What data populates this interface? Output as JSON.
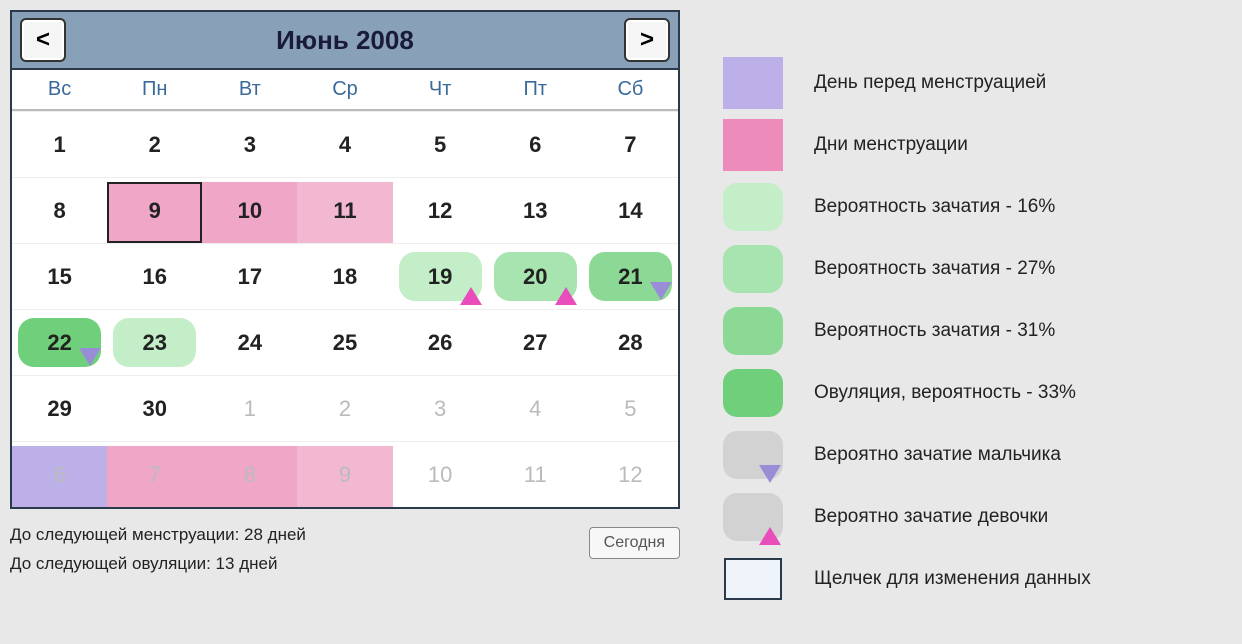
{
  "calendar": {
    "title": "Июнь 2008",
    "weekdays": [
      "Вс",
      "Пн",
      "Вт",
      "Ср",
      "Чт",
      "Пт",
      "Сб"
    ],
    "rows": [
      [
        {
          "n": "1"
        },
        {
          "n": "2"
        },
        {
          "n": "3"
        },
        {
          "n": "4"
        },
        {
          "n": "5"
        },
        {
          "n": "6"
        },
        {
          "n": "7"
        }
      ],
      [
        {
          "n": "8"
        },
        {
          "n": "9",
          "cls": "c-menst-start"
        },
        {
          "n": "10",
          "cls": "c-menst"
        },
        {
          "n": "11",
          "cls": "c-menst-mid"
        },
        {
          "n": "12"
        },
        {
          "n": "13"
        },
        {
          "n": "14"
        }
      ],
      [
        {
          "n": "15"
        },
        {
          "n": "16"
        },
        {
          "n": "17"
        },
        {
          "n": "18"
        },
        {
          "n": "19",
          "cls": "c-fert1",
          "marker": "pink"
        },
        {
          "n": "20",
          "cls": "c-fert2",
          "marker": "pink"
        },
        {
          "n": "21",
          "cls": "c-fert3",
          "marker": "purple"
        }
      ],
      [
        {
          "n": "22",
          "cls": "c-ovul",
          "marker": "purple"
        },
        {
          "n": "23",
          "cls": "c-fert1"
        },
        {
          "n": "24"
        },
        {
          "n": "25"
        },
        {
          "n": "26"
        },
        {
          "n": "27"
        },
        {
          "n": "28"
        }
      ],
      [
        {
          "n": "29"
        },
        {
          "n": "30"
        },
        {
          "n": "1",
          "other": true
        },
        {
          "n": "2",
          "other": true
        },
        {
          "n": "3",
          "other": true
        },
        {
          "n": "4",
          "other": true
        },
        {
          "n": "5",
          "other": true
        }
      ],
      [
        {
          "n": "6",
          "other": true,
          "cls": "c-premenst"
        },
        {
          "n": "7",
          "other": true,
          "cls": "c-menst"
        },
        {
          "n": "8",
          "other": true,
          "cls": "c-menst"
        },
        {
          "n": "9",
          "other": true,
          "cls": "c-menst-mid"
        },
        {
          "n": "10",
          "other": true
        },
        {
          "n": "11",
          "other": true
        },
        {
          "n": "12",
          "other": true
        }
      ]
    ]
  },
  "nav": {
    "prev": "<",
    "next": ">"
  },
  "status": {
    "line1": "До следующей менструации: 28 дней",
    "line2": "До следующей овуляции: 13 дней"
  },
  "today_label": "Сегодня",
  "legend": {
    "items": [
      {
        "kind": "rect",
        "color": "#bdb0e8",
        "text": "День перед менструацией"
      },
      {
        "kind": "rect",
        "color": "#ed8cbb",
        "text": "Дни менструации"
      },
      {
        "kind": "pill",
        "color": "#c3eec7",
        "text": "Вероятность зачатия - 16%"
      },
      {
        "kind": "pill",
        "color": "#a7e4af",
        "text": "Вероятность зачатия - 27%"
      },
      {
        "kind": "pill",
        "color": "#8bd994",
        "text": "Вероятность зачатия - 31%"
      },
      {
        "kind": "pill",
        "color": "#6fcf7a",
        "text": "Овуляция, вероятность - 33%"
      },
      {
        "kind": "gray-tri",
        "tri": "purple",
        "text": "Вероятно зачатие мальчика"
      },
      {
        "kind": "gray-tri",
        "tri": "pink",
        "text": "Вероятно зачатие девочки"
      },
      {
        "kind": "box",
        "text": "Щелчек для изменения данных"
      }
    ]
  },
  "colors": {
    "header": "#88a0b8",
    "premenst": "#bdb0e8",
    "menst": "#f0a6c7",
    "fert1": "#c3eec7",
    "fert2": "#a7e4af",
    "fert3": "#8bd994",
    "ovul": "#6fcf7a"
  }
}
